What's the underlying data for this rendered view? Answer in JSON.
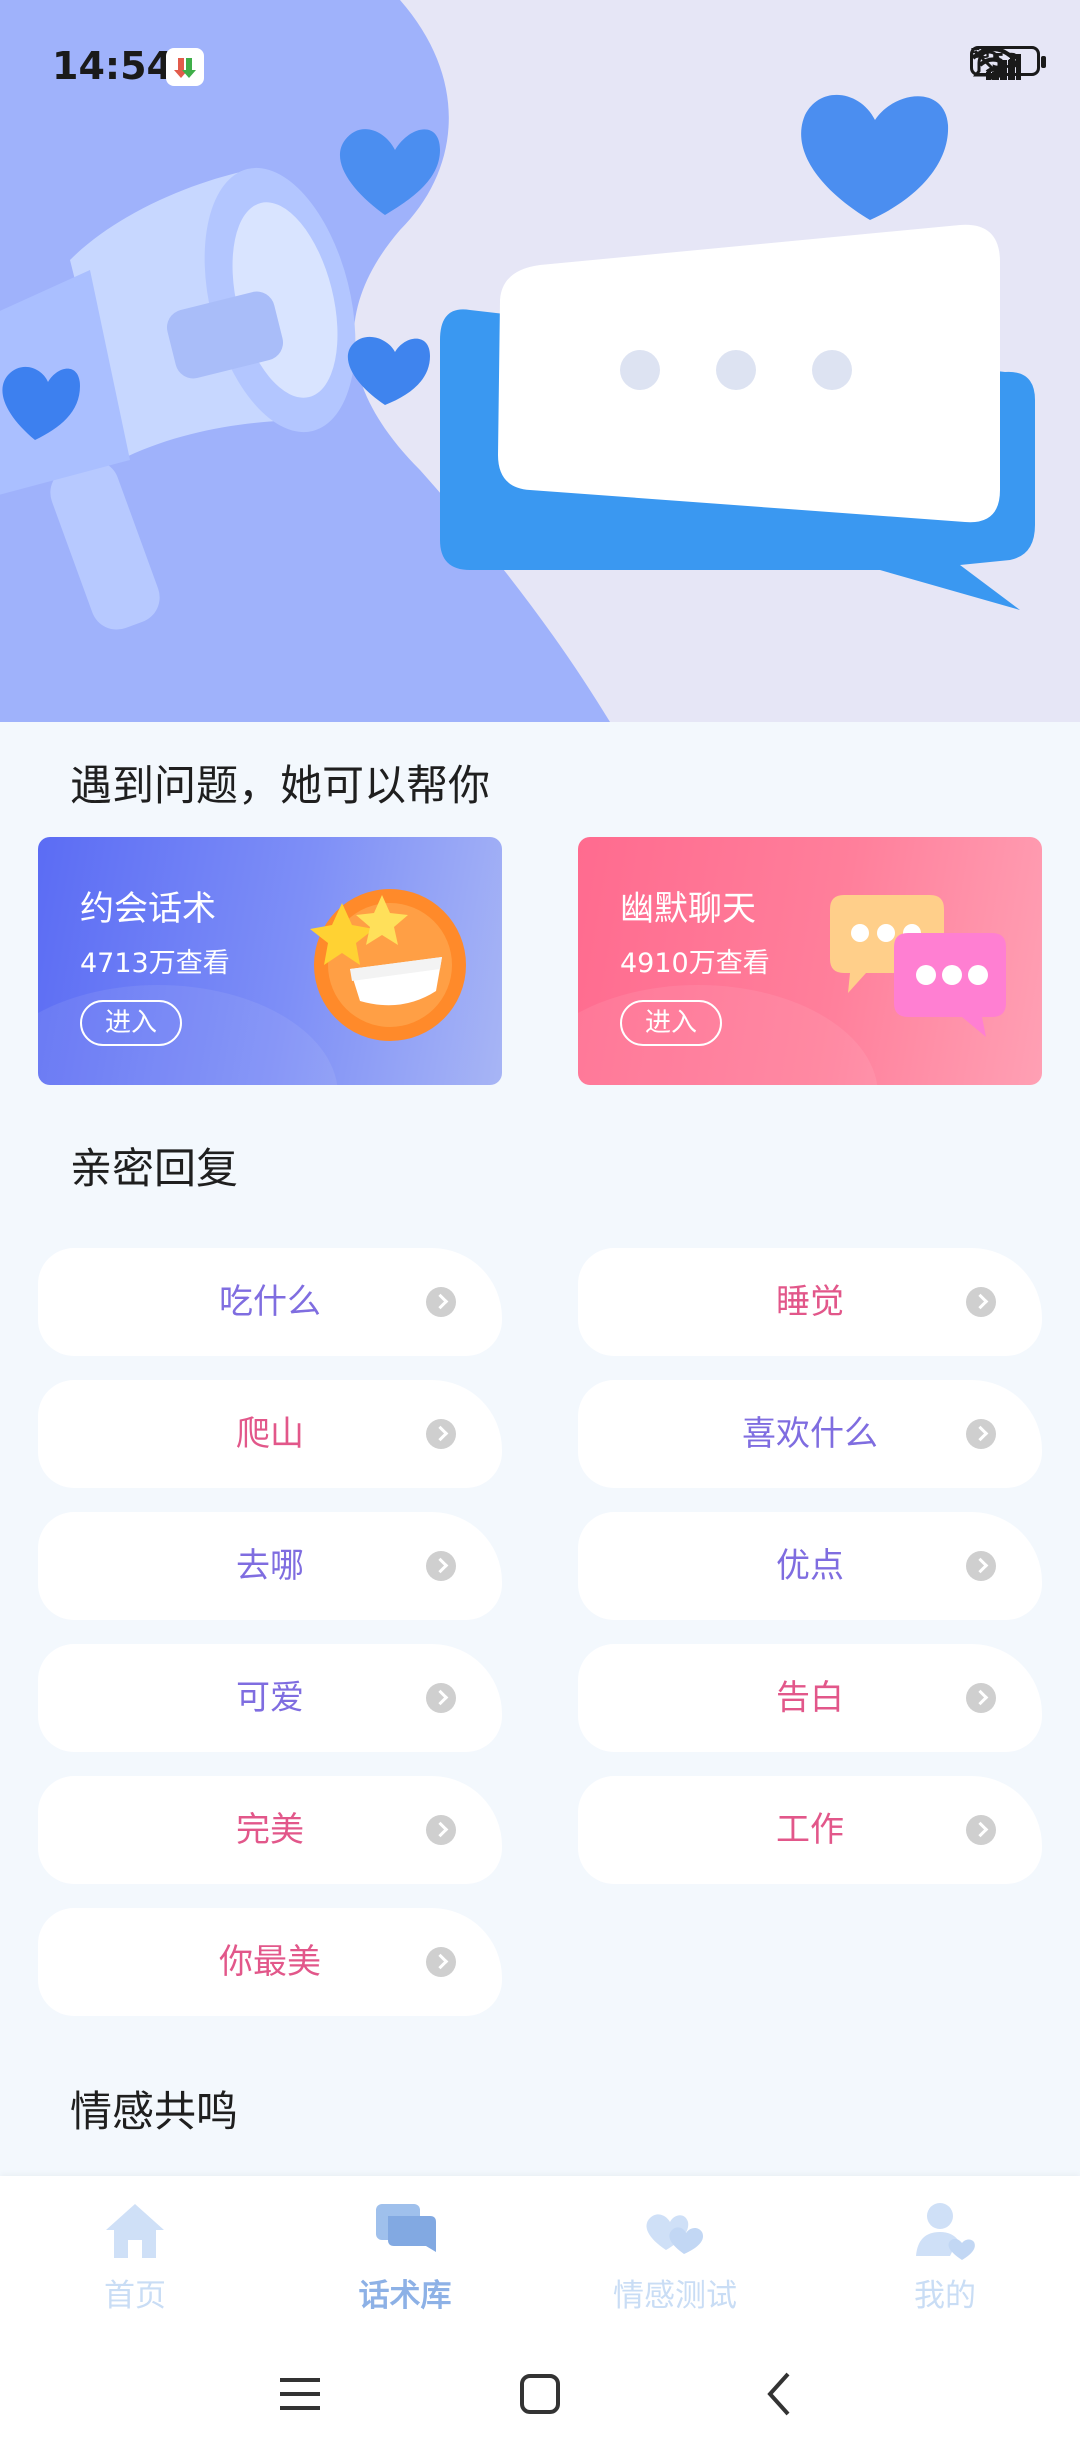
{
  "status_bar": {
    "time": "14:54",
    "battery": "53",
    "icons": [
      "notifications-muted-icon",
      "signal-5g-icon",
      "signal-g-icon",
      "wifi-icon",
      "battery-icon"
    ]
  },
  "hero": {
    "illustration": "megaphone-and-speech-bubble-banner"
  },
  "section_help": {
    "title": "遇到问题，她可以帮你"
  },
  "feature_cards": [
    {
      "title": "约会话术",
      "views": "4713万查看",
      "button": "进入",
      "icon": "laughing-emoji-icon"
    },
    {
      "title": "幽默聊天",
      "views": "4910万查看",
      "button": "进入",
      "icon": "chat-bubbles-icon"
    }
  ],
  "section_replies": {
    "title": "亲密回复",
    "items": [
      {
        "label": "吃什么"
      },
      {
        "label": "睡觉"
      },
      {
        "label": "爬山"
      },
      {
        "label": "喜欢什么"
      },
      {
        "label": "去哪"
      },
      {
        "label": "优点"
      },
      {
        "label": "可爱"
      },
      {
        "label": "告白"
      },
      {
        "label": "完美"
      },
      {
        "label": "工作"
      },
      {
        "label": "你最美"
      }
    ]
  },
  "section_empathy": {
    "title": "情感共鸣"
  },
  "tabbar": {
    "tabs": [
      {
        "label": "首页",
        "icon": "home-icon"
      },
      {
        "label": "话术库",
        "icon": "chat-library-icon"
      },
      {
        "label": "情感测试",
        "icon": "hearts-icon"
      },
      {
        "label": "我的",
        "icon": "profile-icon"
      }
    ],
    "active": "话术库"
  },
  "colors": {
    "accent_blue": "#5b6cf4",
    "accent_pink": "#ff6b8f",
    "label_purple": "#7f6de0",
    "label_pink": "#e2578a",
    "tab_active": "#8db1e6",
    "tab_inactive": "#c9ddf5"
  }
}
